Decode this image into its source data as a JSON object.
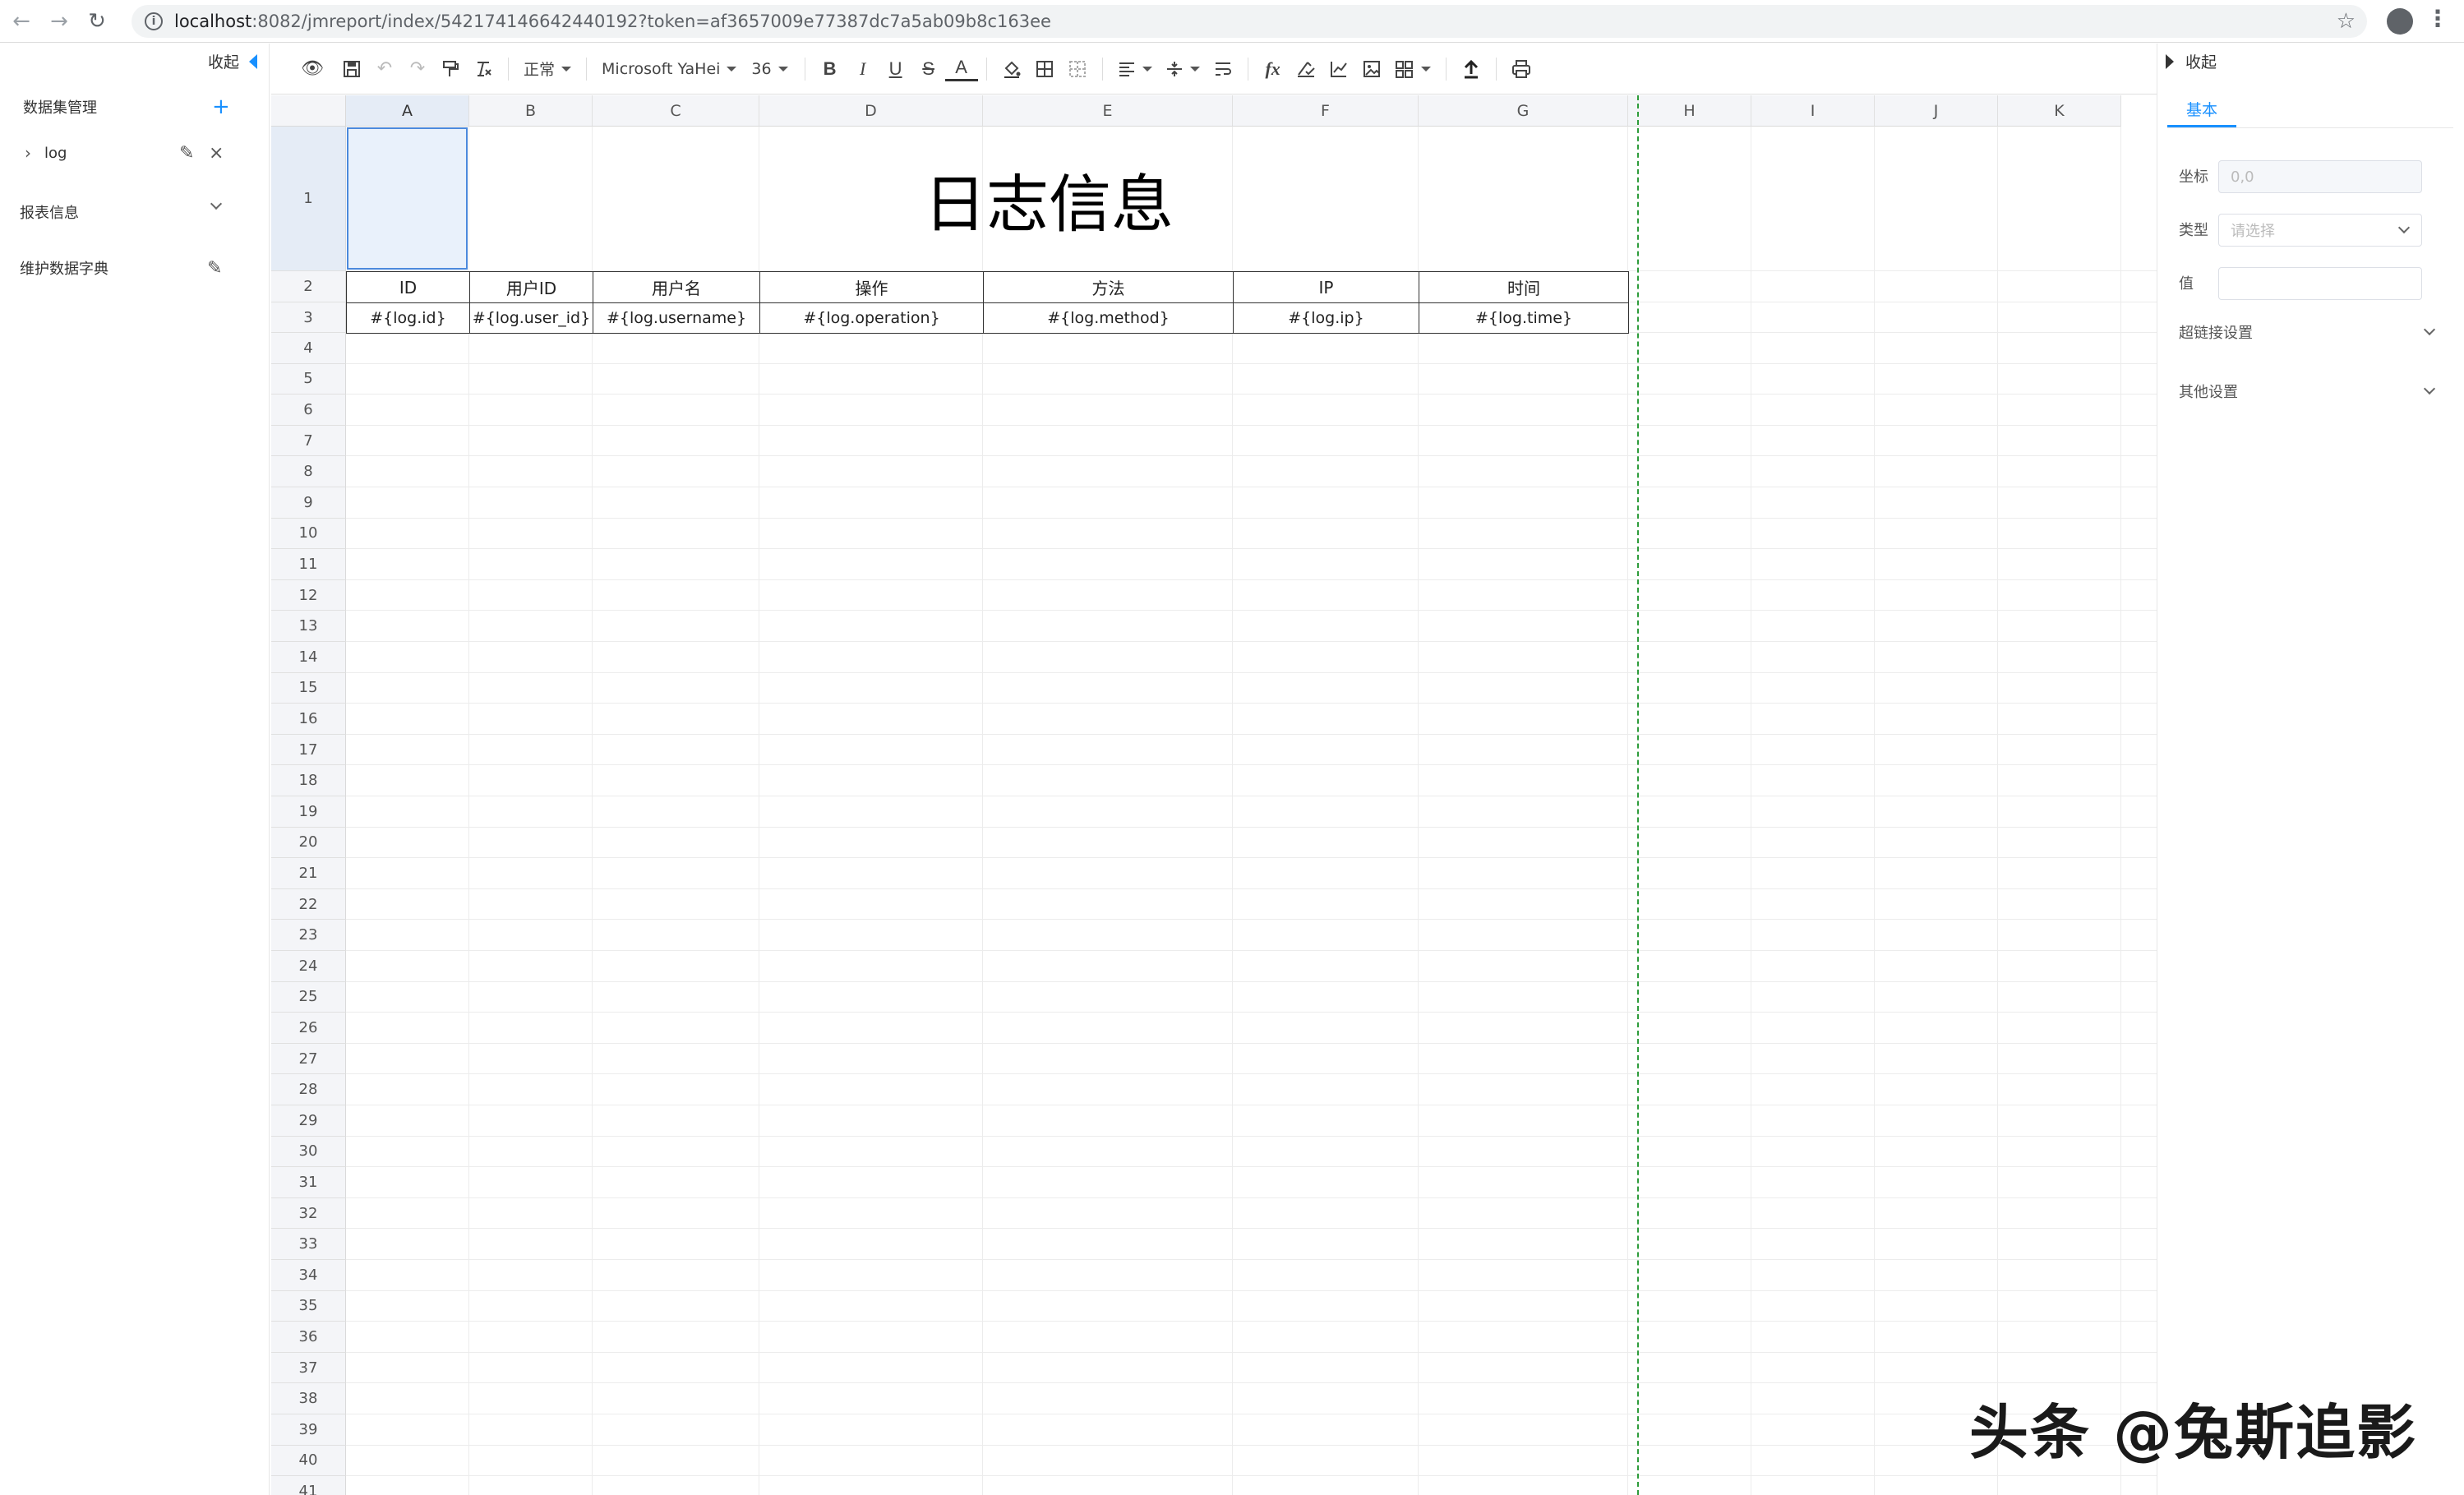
{
  "browser": {
    "url_host": "localhost",
    "url_rest": ":8082/jmreport/index/542174146642440192?token=af3657009e77387dc7a5ab09b8c163ee"
  },
  "left_panel": {
    "collapse_label": "收起",
    "dataset_title": "数据集管理",
    "dataset_item": "log",
    "report_info": "报表信息",
    "dict_maint": "维护数据字典"
  },
  "toolbar": {
    "format_label": "正常",
    "font_family": "Microsoft YaHei",
    "font_size": "36"
  },
  "sheet": {
    "columns": [
      "A",
      "B",
      "C",
      "D",
      "E",
      "F",
      "G",
      "H",
      "I",
      "J",
      "K"
    ],
    "rows": [
      "1",
      "2",
      "3",
      "4",
      "5",
      "6",
      "7",
      "8",
      "9",
      "10",
      "11",
      "12",
      "13",
      "14",
      "15",
      "16",
      "17",
      "18",
      "19",
      "20",
      "21",
      "22",
      "23",
      "24",
      "25",
      "26",
      "27",
      "28",
      "29",
      "30",
      "31",
      "32",
      "33",
      "34",
      "35",
      "36",
      "37",
      "38",
      "39",
      "40",
      "41"
    ],
    "title": "日志信息",
    "header_cells": [
      "ID",
      "用户ID",
      "用户名",
      "操作",
      "方法",
      "IP",
      "时间"
    ],
    "data_cells": [
      "#{log.id}",
      "#{log.user_id}",
      "#{log.username}",
      "#{log.operation}",
      "#{log.method}",
      "#{log.ip}",
      "#{log.time}"
    ]
  },
  "right_panel": {
    "collapse_label": "收起",
    "tab_basic": "基本",
    "coord_label": "坐标",
    "coord_value": "0,0",
    "type_label": "类型",
    "type_placeholder": "请选择",
    "value_label": "值",
    "hyperlink_settings": "超链接设置",
    "other_settings": "其他设置"
  },
  "watermark": "头条 @兔斯追影"
}
